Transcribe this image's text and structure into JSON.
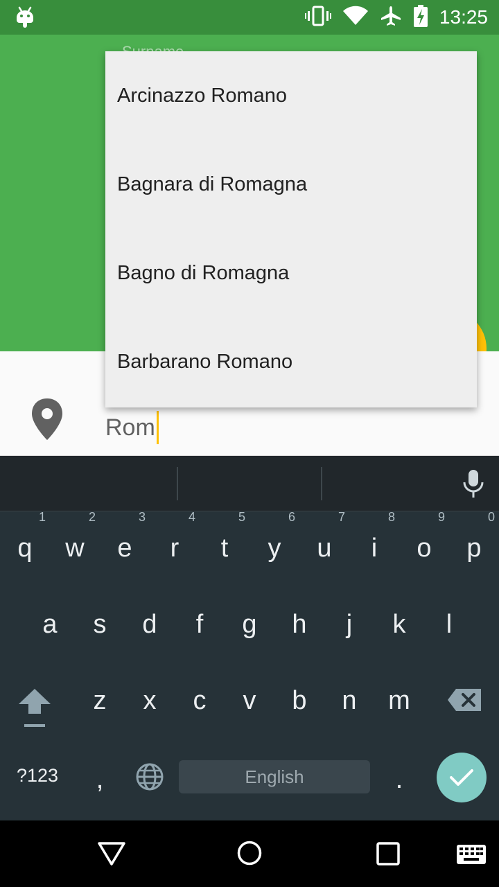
{
  "status_bar": {
    "time": "13:25",
    "icons": [
      "android-icon",
      "vibrate-icon",
      "wifi-icon",
      "airplane-icon",
      "battery-charging-icon"
    ]
  },
  "header": {
    "hint": "Surname"
  },
  "city_input": {
    "value": "Rom"
  },
  "dropdown": {
    "items": [
      "Arcinazzo Romano",
      "Bagnara di Romagna",
      "Bagno di Romagna",
      "Barbarano Romano"
    ]
  },
  "keyboard": {
    "row1": [
      {
        "key": "q",
        "hint": "1"
      },
      {
        "key": "w",
        "hint": "2"
      },
      {
        "key": "e",
        "hint": "3"
      },
      {
        "key": "r",
        "hint": "4"
      },
      {
        "key": "t",
        "hint": "5"
      },
      {
        "key": "y",
        "hint": "6"
      },
      {
        "key": "u",
        "hint": "7"
      },
      {
        "key": "i",
        "hint": "8"
      },
      {
        "key": "o",
        "hint": "9"
      },
      {
        "key": "p",
        "hint": "0"
      }
    ],
    "row2": [
      "a",
      "s",
      "d",
      "f",
      "g",
      "h",
      "j",
      "k",
      "l"
    ],
    "row3": [
      "z",
      "x",
      "c",
      "v",
      "b",
      "n",
      "m"
    ],
    "symbols_label": "?123",
    "comma_label": ",",
    "space_label": "English",
    "period_label": "."
  },
  "colors": {
    "status_bar": "#388E3C",
    "header": "#4CAF50",
    "accent": "#FFC107",
    "keyboard": "#263238",
    "enter": "#80CBC4"
  }
}
